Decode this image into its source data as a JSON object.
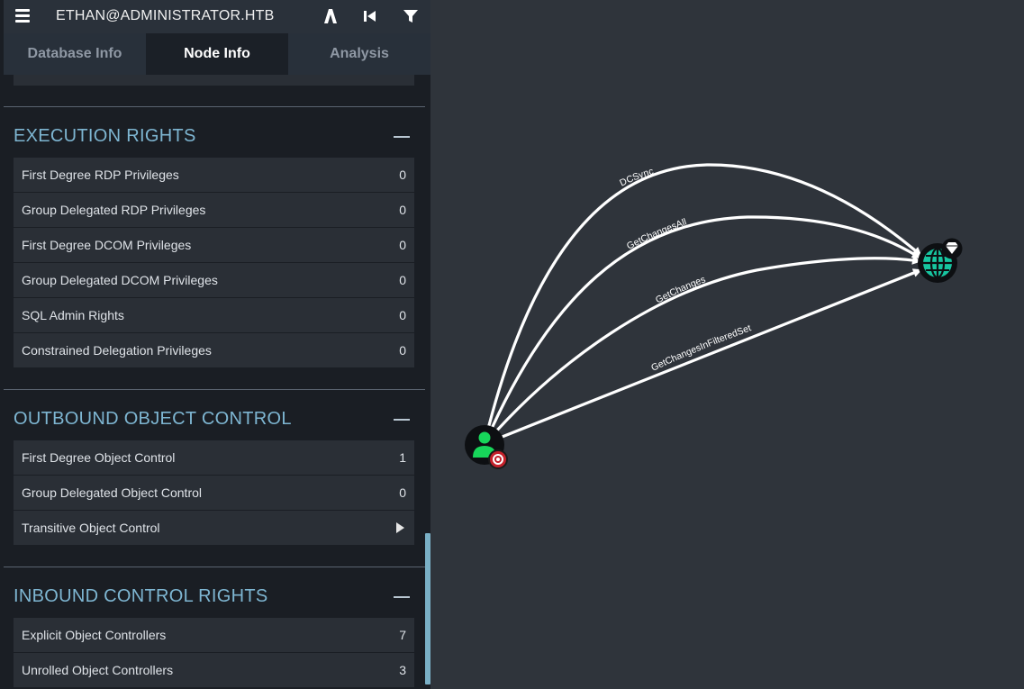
{
  "header": {
    "title": "ETHAN@ADMINISTRATOR.HTB",
    "icons": [
      "menu-icon",
      "pathfinding-icon",
      "back-icon",
      "filter-icon"
    ]
  },
  "tabs": [
    {
      "label": "Database Info",
      "active": false
    },
    {
      "label": "Node Info",
      "active": true
    },
    {
      "label": "Analysis",
      "active": false
    }
  ],
  "sections": {
    "execution": {
      "title": "EXECUTION RIGHTS",
      "rows": [
        {
          "label": "First Degree RDP Privileges",
          "value": "0"
        },
        {
          "label": "Group Delegated RDP Privileges",
          "value": "0"
        },
        {
          "label": "First Degree DCOM Privileges",
          "value": "0"
        },
        {
          "label": "Group Delegated DCOM Privileges",
          "value": "0"
        },
        {
          "label": "SQL Admin Rights",
          "value": "0"
        },
        {
          "label": "Constrained Delegation Privileges",
          "value": "0"
        }
      ]
    },
    "outbound": {
      "title": "OUTBOUND OBJECT CONTROL",
      "rows": [
        {
          "label": "First Degree Object Control",
          "value": "1"
        },
        {
          "label": "Group Delegated Object Control",
          "value": "0"
        },
        {
          "label": "Transitive Object Control",
          "value": ""
        }
      ]
    },
    "inbound": {
      "title": "INBOUND CONTROL RIGHTS",
      "rows": [
        {
          "label": "Explicit Object Controllers",
          "value": "7"
        },
        {
          "label": "Unrolled Object Controllers",
          "value": "3"
        }
      ]
    }
  },
  "graph": {
    "edges": [
      {
        "label": "DCSync"
      },
      {
        "label": "GetChangesAll"
      },
      {
        "label": "GetChanges"
      },
      {
        "label": "GetChangesInFilteredSet"
      }
    ],
    "nodes": [
      {
        "type": "user",
        "icon": "user-icon",
        "badge": "target-icon"
      },
      {
        "type": "domain",
        "icon": "globe-icon",
        "badge": "diamond-icon"
      }
    ],
    "colors": {
      "background": "#2f343b",
      "user": "#17d65a",
      "domain": "#17c5a0",
      "edge": "#ffffff",
      "accent": "#7eb6d2"
    }
  }
}
